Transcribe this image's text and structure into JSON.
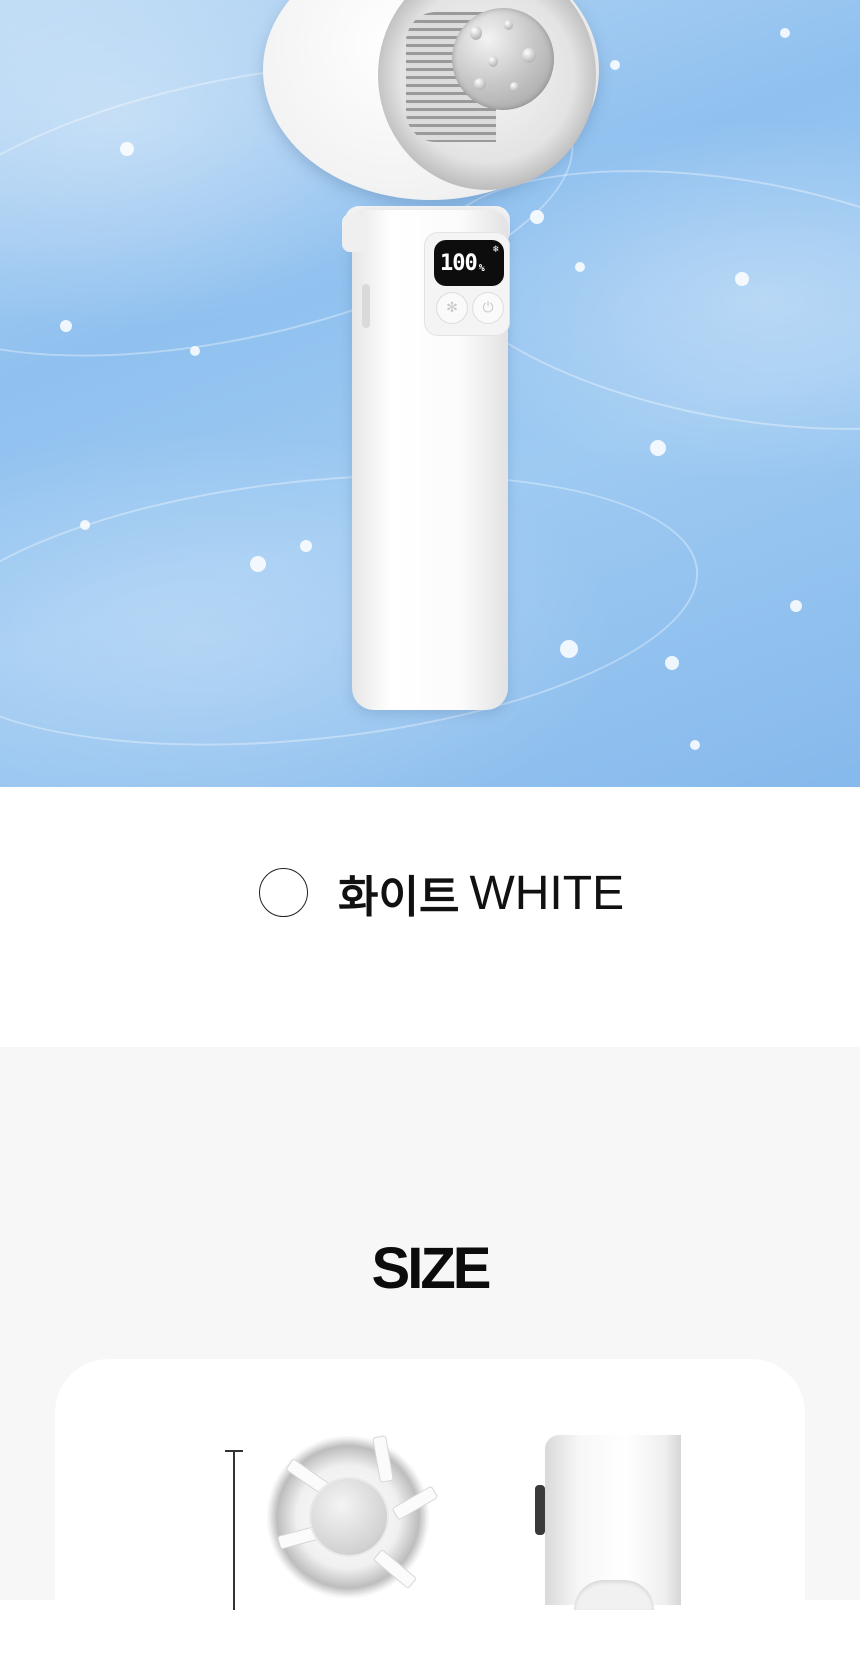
{
  "hero": {
    "product_image": "handheld-fan-white",
    "display_value": "100",
    "display_unit": "%",
    "display_symbol": "❄",
    "button_icons": [
      "snowflake-icon",
      "fan-mode-icon"
    ]
  },
  "color_option": {
    "swatch_color": "#ffffff",
    "name_korean": "화이트",
    "name_english": "WHITE"
  },
  "size_section": {
    "title": "SIZE",
    "background": "#f7f7f7",
    "card_color": "#ffffff",
    "views": [
      "front-view-fan",
      "side-view-fan"
    ]
  }
}
